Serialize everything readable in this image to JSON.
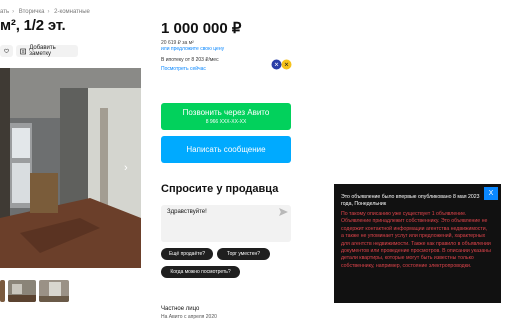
{
  "breadcrumbs": [
    "ать",
    "Вторичка",
    "2-комнатные"
  ],
  "listing": {
    "title": "м², 1/2 эт."
  },
  "actions": {
    "favorite_label": "",
    "note_label": "Добавить заметку"
  },
  "price": {
    "value": "1 000 000 ₽",
    "per_meter": "20 619 ₽ за м²",
    "offer_link": "или предложите свою цену",
    "mortgage": "В ипотеку от 8 203 ₽/мес",
    "mortgage_link": "Посмотреть сейчас"
  },
  "contact": {
    "call_label": "Позвонить через Авито",
    "phone": "8 966 XXX-XX-XX",
    "message_label": "Написать сообщение"
  },
  "ask": {
    "heading": "Спросите у продавца",
    "input_value": "Здравствуйте!",
    "chips": [
      "Ещё продаёте?",
      "Торг уместен?",
      "Когда можно посмотреть?"
    ]
  },
  "seller": {
    "type": "Частное лицо",
    "since": "На Авито с апреля 2020"
  },
  "tooltip": {
    "title": "Это объявление было впервые опубликовано 8 мая 2023 года, Понедельник",
    "body": "По такому описанию уже существует 1 объявление. Объявление принадлежит собственнику. Это объявление не содержит контактной информации агентства недвижимости, а также не упоминает услуг или предложений, характерных для агентств недвижимости. Также как правило в объявлении документов или проведение просмотров. В описании указаны детали квартиры, которые могут быть известны только собственнику, например, состояние электропроводки.",
    "close_label": "X"
  },
  "colors": {
    "call": "#02d15c",
    "message": "#00aaff",
    "link": "#0a88ff",
    "tooltip_bg": "#111111",
    "tooltip_text": "#e0444b"
  }
}
